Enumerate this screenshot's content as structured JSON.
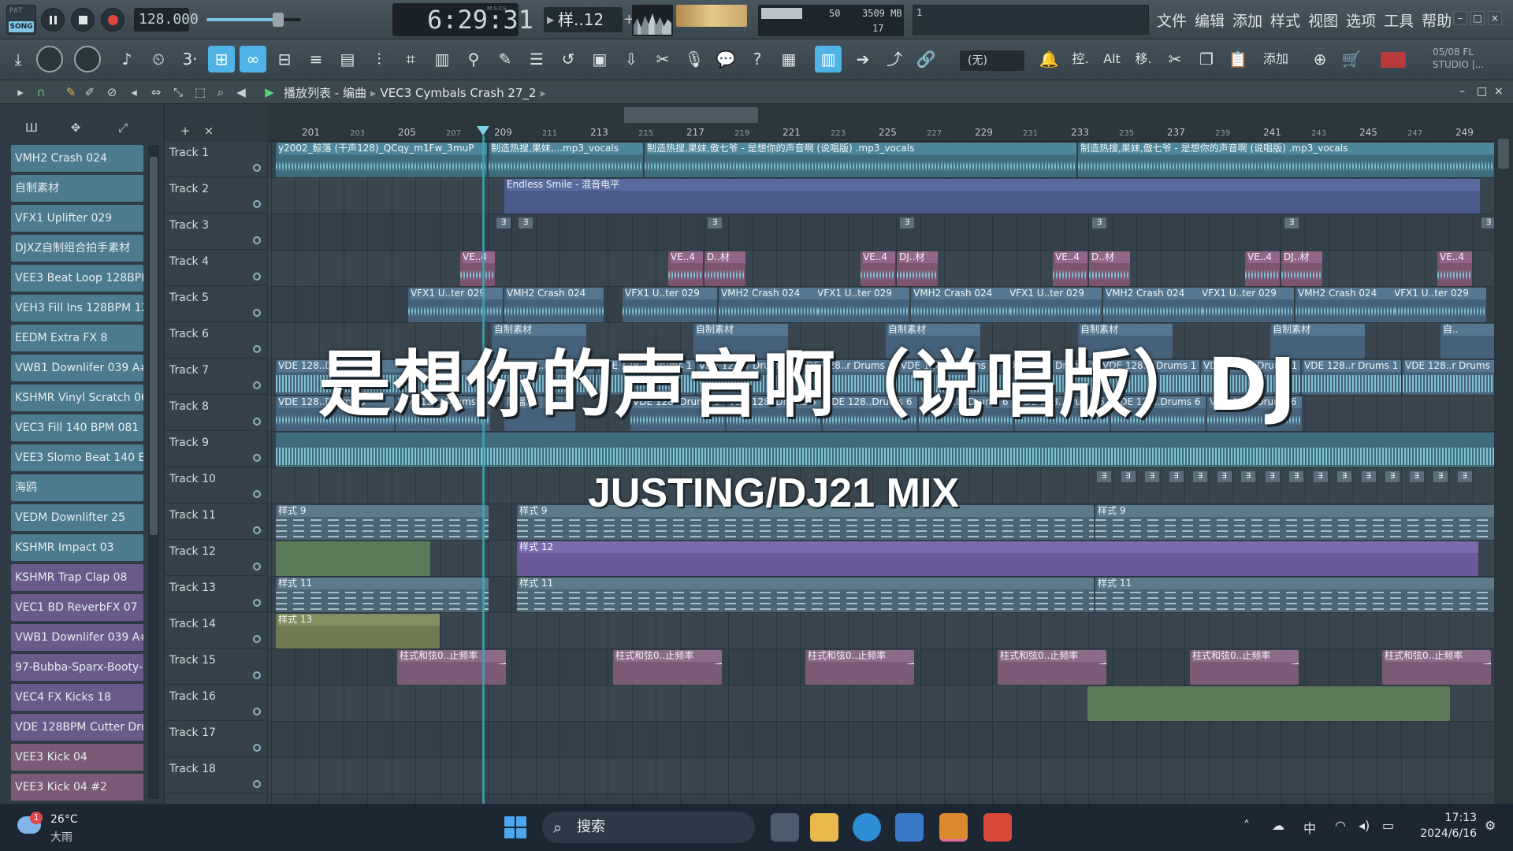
{
  "transport": {
    "pat_label": "PAT",
    "song_label": "SONG",
    "tempo": "128.000",
    "time": "6:29:31",
    "time_sub": "M:S:CS",
    "pattern": "样..12",
    "cpu": "50",
    "memory": "3509 MB",
    "polyphony": "17",
    "hint": "1"
  },
  "menu": [
    "文件",
    "编辑",
    "添加",
    "样式",
    "视图",
    "选项",
    "工具",
    "帮助"
  ],
  "toolbar2": {
    "none_label": "(无)",
    "alt_label": "Alt",
    "move_label": "移.",
    "control_label": "控.",
    "add_label": "添加",
    "version_line1": "05/08  FL",
    "version_line2": "STUDIO |..."
  },
  "playlist": {
    "crumb_root": "播放列表 - 编曲",
    "crumb_item": "VEC3 Cymbals Crash 27_2"
  },
  "browser": {
    "items": [
      {
        "label": "VMH2 Crash 024",
        "color": "#4c7b8d"
      },
      {
        "label": "自制素材",
        "color": "#4c7b8d"
      },
      {
        "label": "VFX1 Uplifter 029",
        "color": "#4c7b8d"
      },
      {
        "label": "DJXZ自制组合拍手素材",
        "color": "#4c7b8d"
      },
      {
        "label": "VEE3 Beat Loop 128BPM 13",
        "color": "#4c7b8d"
      },
      {
        "label": "VEH3 Fill Ins 128BPM 120",
        "color": "#4c7b8d"
      },
      {
        "label": "EEDM Extra FX 8",
        "color": "#4c7b8d"
      },
      {
        "label": "VWB1 Downlifer 039 A#",
        "color": "#4c7b8d"
      },
      {
        "label": "KSHMR Vinyl Scratch 06 (1...",
        "color": "#4c7b8d"
      },
      {
        "label": "VEC3 Fill 140 BPM 081",
        "color": "#4c7b8d"
      },
      {
        "label": "VEE3 Slomo Beat 140 BPM...",
        "color": "#4c7b8d"
      },
      {
        "label": "海鸥",
        "color": "#4c7b8d"
      },
      {
        "label": "VEDM Downlifter 25",
        "color": "#4c7b8d"
      },
      {
        "label": "KSHMR Impact 03",
        "color": "#4c7b8d"
      },
      {
        "label": "KSHMR Trap Clap 08",
        "color": "#6a5a8a"
      },
      {
        "label": "VEC1 BD ReverbFX 07",
        "color": "#6a5a8a"
      },
      {
        "label": "VWB1 Downlifer 039 A# #2",
        "color": "#6a5a8a"
      },
      {
        "label": "97-Bubba-Sparx-Booty-...",
        "color": "#6a5a8a"
      },
      {
        "label": "VEC4 FX Kicks 18",
        "color": "#6a5a8a"
      },
      {
        "label": "VDE 128BPM Cutter Drums...",
        "color": "#6a5a8a"
      },
      {
        "label": "VEE3 Kick 04",
        "color": "#7a5a76"
      },
      {
        "label": "VEE3 Kick 04 #2",
        "color": "#7a5a76"
      }
    ]
  },
  "tracks": [
    "Track 1",
    "Track 2",
    "Track 3",
    "Track 4",
    "Track 5",
    "Track 6",
    "Track 7",
    "Track 8",
    "Track 9",
    "Track 10",
    "Track 11",
    "Track 12",
    "Track 13",
    "Track 14",
    "Track 15",
    "Track 16",
    "Track 17",
    "Track 18"
  ],
  "ruler": {
    "major": [
      "201",
      "205",
      "209",
      "213",
      "217",
      "221",
      "225",
      "229",
      "233",
      "237",
      "241",
      "245",
      "249"
    ],
    "minor": [
      "203",
      "207",
      "211",
      "215",
      "219",
      "223",
      "227",
      "231",
      "235",
      "239",
      "243",
      "247"
    ]
  },
  "clips": {
    "t1_a": "y2002_鲸落 (干声128)_QCqy_m1Fw_3muP",
    "t1_b": "制造热搜,果妹,...mp3_vocals",
    "t1_c": "制造热搜,果妹,傲七爷 - 是想你的声音啊 (说唱版) .mp3_vocals",
    "t1_d": "制造热搜,果妹,傲七爷 - 是想你的声音啊 (说唱版) .mp3_vocals",
    "t2": "Endless Smile - 混音电平",
    "t4_a": "VE..4",
    "t4_b": "D..材",
    "t4_c": "DJ..材",
    "t5_a": "VFX1 U..ter 029",
    "t5_b": "VMH2 Crash 024",
    "t6": "自制素材",
    "t6_end": "自..",
    "t7_a": "VDE 128..r Drums 1",
    "t7_b": "VDE 128..Drums 1",
    "t8_a": "VDE 128..Drums 6",
    "t8_b": "阿福..2",
    "t11": "样式 9",
    "t12": "样式 12",
    "t13": "样式 11",
    "t14": "样式 13",
    "t15": "柱式和弦0..止频率"
  },
  "overlay": {
    "title": "是想你的声音啊（说唱版）DJ",
    "subtitle": "JUSTING/DJ21 MIX"
  },
  "taskbar": {
    "weather_badge": "1",
    "temperature": "26°C",
    "condition": "大雨",
    "search": "搜索",
    "ime": "中",
    "time": "17:13",
    "date": "2024/6/16"
  }
}
